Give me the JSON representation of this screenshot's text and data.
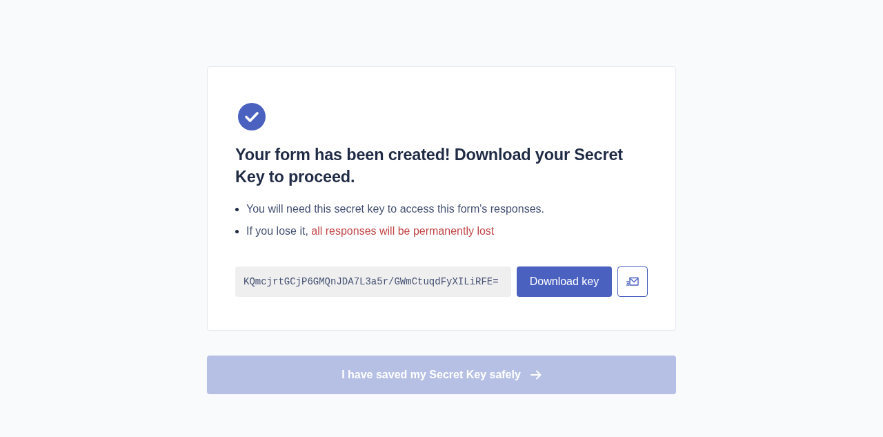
{
  "card": {
    "heading": "Your form has been created! Download your Secret Key to proceed.",
    "bullets": [
      {
        "text": "You will need this secret key to access this form's responses."
      },
      {
        "text": "If you lose it, ",
        "warning": "all responses will be permanently lost"
      }
    ],
    "secret_key": {
      "value": "KQmcjrtGCjP6GMQnJDA7L3a5r/GWmCtuqdFyXILiRFE="
    },
    "download_button": {
      "label": "Download key"
    }
  },
  "continue_button": {
    "label": "I have saved my Secret Key safely",
    "disabled": true
  }
}
